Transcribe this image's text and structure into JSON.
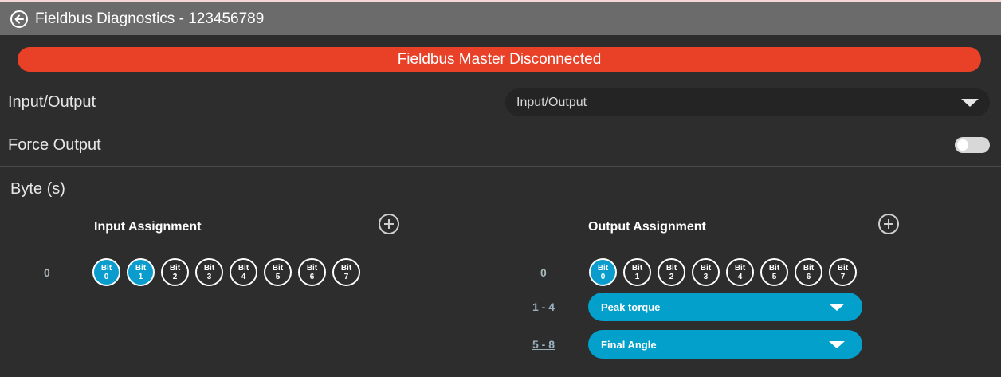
{
  "header": {
    "title": "Fieldbus Diagnostics - 123456789",
    "back_icon": "arrow-left-circle-icon"
  },
  "status": {
    "message": "Fieldbus Master Disconnected",
    "color": "#e84128"
  },
  "io_row": {
    "label": "Input/Output",
    "selected": "Input/Output"
  },
  "force_row": {
    "label": "Force Output",
    "toggle_on": false
  },
  "bytes": {
    "label": "Byte (s)"
  },
  "input_assignment": {
    "title": "Input Assignment",
    "rows": [
      {
        "index": "0",
        "bits": [
          {
            "top": "Bit",
            "num": "0",
            "on": true
          },
          {
            "top": "Bit",
            "num": "1",
            "on": true
          },
          {
            "top": "Bit",
            "num": "2",
            "on": false
          },
          {
            "top": "Bit",
            "num": "3",
            "on": false
          },
          {
            "top": "Bit",
            "num": "4",
            "on": false
          },
          {
            "top": "Bit",
            "num": "5",
            "on": false
          },
          {
            "top": "Bit",
            "num": "6",
            "on": false
          },
          {
            "top": "Bit",
            "num": "7",
            "on": false
          }
        ]
      }
    ]
  },
  "output_assignment": {
    "title": "Output Assignment",
    "rows": [
      {
        "index": "0",
        "bits": [
          {
            "top": "Bit",
            "num": "0",
            "on": true
          },
          {
            "top": "Bit",
            "num": "1",
            "on": false
          },
          {
            "top": "Bit",
            "num": "2",
            "on": false
          },
          {
            "top": "Bit",
            "num": "3",
            "on": false
          },
          {
            "top": "Bit",
            "num": "4",
            "on": false
          },
          {
            "top": "Bit",
            "num": "5",
            "on": false
          },
          {
            "top": "Bit",
            "num": "6",
            "on": false
          },
          {
            "top": "Bit",
            "num": "7",
            "on": false
          }
        ]
      }
    ],
    "ranges": [
      {
        "range": "1 - 4",
        "value": "Peak torque"
      },
      {
        "range": "5 - 8",
        "value": "Final Angle"
      }
    ]
  },
  "colors": {
    "accent": "#04a0cc",
    "background": "#2d2d2d",
    "header": "#6b6b6b"
  }
}
